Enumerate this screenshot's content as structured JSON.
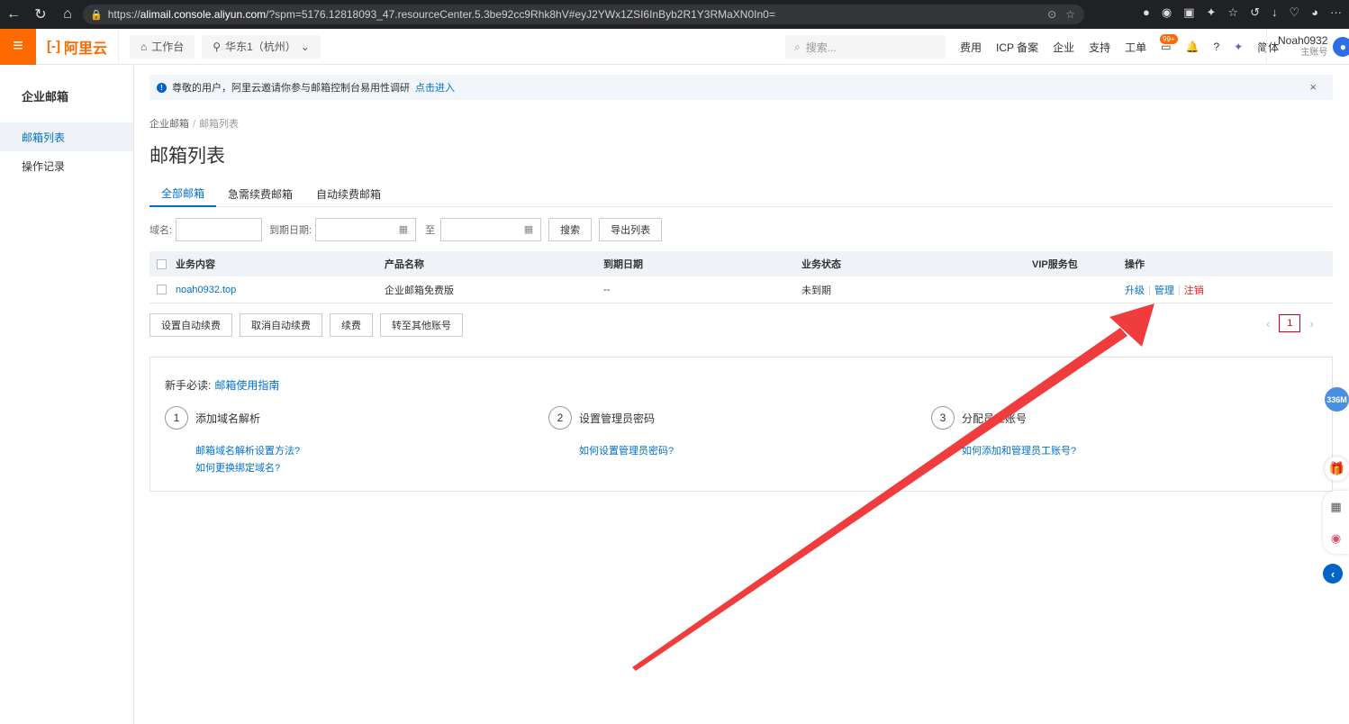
{
  "browser": {
    "url_prefix": "https://",
    "url_host": "alimail.console.aliyun.com",
    "url_rest": "/?spm=5176.12818093_47.resourceCenter.5.3be92cc9Rhk8hV#eyJ2YWx1ZSI6InByb2R1Y3RMaXN0In0="
  },
  "topbar": {
    "logo_text": "阿里云",
    "workbench": "工作台",
    "region": "华东1（杭州）",
    "search_placeholder": "搜索...",
    "links": [
      "费用",
      "ICP 备案",
      "企业",
      "支持",
      "工单"
    ],
    "notif_badge": "99+",
    "lang": "简体",
    "user_name": "Noah0932",
    "user_role": "主账号"
  },
  "sidebar": {
    "title": "企业邮箱",
    "items": [
      {
        "label": "邮箱列表",
        "active": true
      },
      {
        "label": "操作记录",
        "active": false
      }
    ]
  },
  "notice": {
    "text": "尊敬的用户，阿里云邀请你参与邮箱控制台易用性调研",
    "link": "点击进入"
  },
  "breadcrumb": {
    "parent": "企业邮箱",
    "current": "邮箱列表"
  },
  "page_title": "邮箱列表",
  "tabs": [
    "全部邮箱",
    "急需续费邮箱",
    "自动续费邮箱"
  ],
  "filter": {
    "domain_label": "域名:",
    "date_label": "到期日期:",
    "to_label": "至",
    "search_btn": "搜索",
    "export_btn": "导出列表"
  },
  "table": {
    "headers": [
      "业务内容",
      "产品名称",
      "到期日期",
      "业务状态",
      "VIP服务包",
      "操作"
    ],
    "rows": [
      {
        "domain": "noah0932.top",
        "product": "企业邮箱免费版",
        "expire": "--",
        "status": "未到期",
        "vip": "",
        "ops": [
          "升级",
          "管理",
          "注销"
        ]
      }
    ]
  },
  "bottom_buttons": [
    "设置自动续费",
    "取消自动续费",
    "续费",
    "转至其他账号"
  ],
  "pager": {
    "current": "1"
  },
  "guide": {
    "title": "新手必读:",
    "title_link": "邮箱使用指南",
    "steps": [
      {
        "num": "1",
        "label": "添加域名解析",
        "links": [
          "邮箱域名解析设置方法?",
          "如何更换绑定域名?"
        ]
      },
      {
        "num": "2",
        "label": "设置管理员密码",
        "links": [
          "如何设置管理员密码?"
        ]
      },
      {
        "num": "3",
        "label": "分配员工账号",
        "links": [
          "如何添加和管理员工账号?"
        ]
      }
    ]
  },
  "floating": {
    "badge": "336M"
  },
  "colors": {
    "brand": "#ff6a00",
    "link": "#0070cc",
    "danger": "#e02020",
    "arrow": "#f03c3c"
  }
}
